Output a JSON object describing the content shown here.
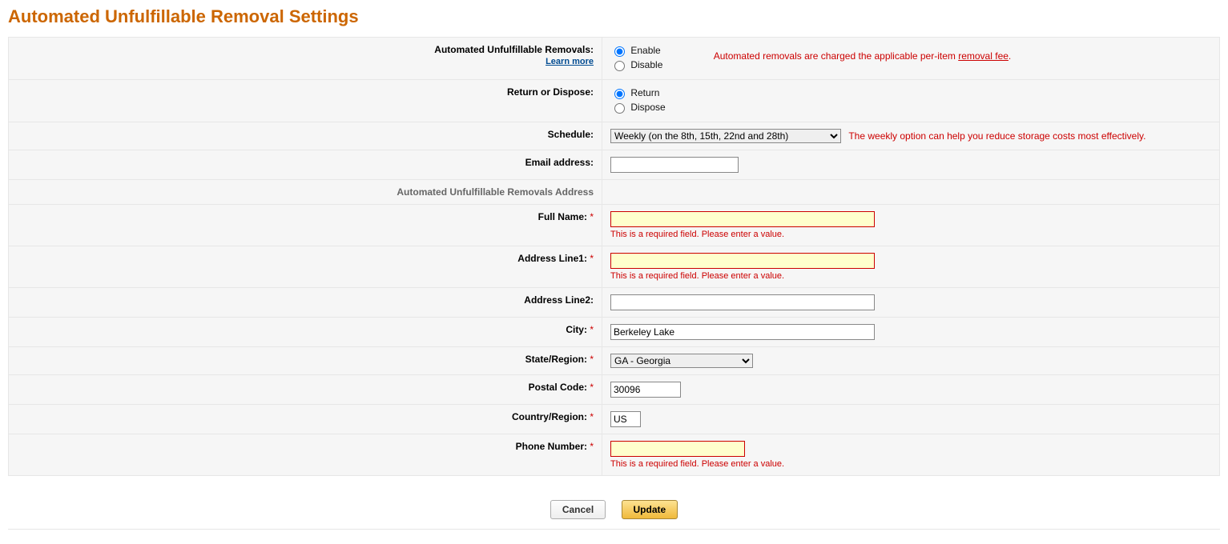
{
  "page": {
    "title": "Automated Unfulfillable Removal Settings"
  },
  "rows": {
    "removals": {
      "label": "Automated Unfulfillable Removals:",
      "learn_more": "Learn more",
      "enable_label": "Enable",
      "disable_label": "Disable",
      "note_prefix": "Automated removals are charged the applicable per-item ",
      "note_link": "removal fee",
      "note_suffix": "."
    },
    "return_dispose": {
      "label": "Return or Dispose:",
      "return_label": "Return",
      "dispose_label": "Dispose"
    },
    "schedule": {
      "label": "Schedule:",
      "selected": "Weekly (on the 8th, 15th, 22nd and 28th)",
      "note": "The weekly option can help you reduce storage costs most effectively."
    },
    "email": {
      "label": "Email address:",
      "value": ""
    },
    "section_address": "Automated Unfulfillable Removals Address",
    "full_name": {
      "label": "Full Name:",
      "value": "",
      "error": "This is a required field. Please enter a value."
    },
    "addr1": {
      "label": "Address Line1:",
      "value": "",
      "error": "This is a required field. Please enter a value."
    },
    "addr2": {
      "label": "Address Line2:",
      "value": ""
    },
    "city": {
      "label": "City:",
      "value": "Berkeley Lake"
    },
    "state": {
      "label": "State/Region:",
      "selected": "GA - Georgia"
    },
    "postal": {
      "label": "Postal Code:",
      "value": "30096"
    },
    "country": {
      "label": "Country/Region:",
      "value": "US"
    },
    "phone": {
      "label": "Phone Number:",
      "value": "",
      "error": "This is a required field. Please enter a value."
    }
  },
  "buttons": {
    "cancel": "Cancel",
    "update": "Update"
  },
  "required_mark": "*"
}
